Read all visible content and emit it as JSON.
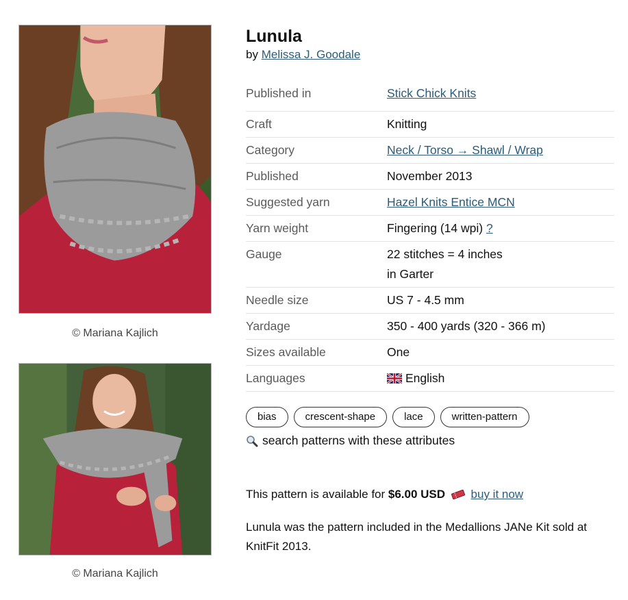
{
  "photos": {
    "credit_1": "© Mariana Kajlich",
    "credit_2": "© Mariana Kajlich"
  },
  "pattern": {
    "title": "Lunula",
    "by_prefix": "by",
    "designer": "Melissa J. Goodale"
  },
  "details": [
    {
      "label": "Published in",
      "value": "Stick Chick Knits",
      "link": true
    },
    {
      "label": "Craft",
      "value": "Knitting",
      "link": false
    },
    {
      "label": "Category",
      "value": "Neck / Torso → Shawl / Wrap",
      "link": true
    },
    {
      "label": "Published",
      "value": "November 2013",
      "link": false
    },
    {
      "label": "Suggested yarn",
      "value": "Hazel Knits Entice MCN",
      "link": true
    },
    {
      "label": "Yarn weight",
      "value": "Fingering (14 wpi)",
      "help": "?",
      "link": false
    },
    {
      "label": "Gauge",
      "value": "22 stitches = 4 inches",
      "value2": "in Garter",
      "link": false
    },
    {
      "label": "Needle size",
      "value": "US 7 - 4.5 mm",
      "link": false
    },
    {
      "label": "Yardage",
      "value": "350 - 400 yards (320 - 366 m)",
      "link": false
    },
    {
      "label": "Sizes available",
      "value": "One",
      "link": false
    },
    {
      "label": "Languages",
      "value": "English",
      "flag": "uk-flag-icon",
      "link": false
    }
  ],
  "tags": [
    "bias",
    "crescent-shape",
    "lace",
    "written-pattern"
  ],
  "search_attributes_label": "search patterns with these attributes",
  "purchase": {
    "prefix": "This pattern is available for",
    "price": "$6.00 USD",
    "buy_label": "buy it now"
  },
  "description": "Lunula was the pattern included in the Medallions JANe Kit sold at KnitFit 2013.",
  "colors": {
    "link": "#2a5c7a",
    "shawl_gray": "#9b9b9c",
    "sweater_red": "#b8213a",
    "foliage": "#3d5a2c"
  }
}
